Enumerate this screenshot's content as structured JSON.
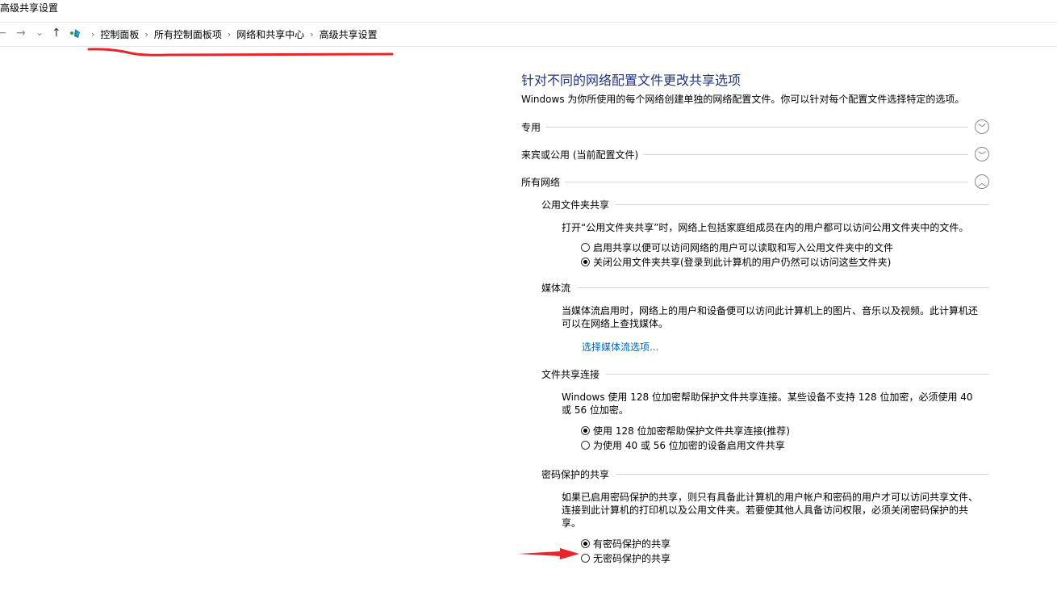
{
  "window": {
    "title": "高级共享设置"
  },
  "nav": {
    "back": "←",
    "forward": "→",
    "recent": "⌄",
    "up": "↑",
    "breadcrumb": [
      "控制面板",
      "所有控制面板项",
      "网络和共享中心",
      "高级共享设置"
    ],
    "separator": "›"
  },
  "main": {
    "heading": "针对不同的网络配置文件更改共享选项",
    "intro": "Windows 为你所使用的每个网络创建单独的网络配置文件。你可以针对每个配置文件选择特定的选项。",
    "profiles": [
      {
        "label": "专用",
        "state": "collapsed",
        "chevron": "﹀"
      },
      {
        "label": "来宾或公用 (当前配置文件)",
        "state": "collapsed",
        "chevron": "﹀"
      },
      {
        "label": "所有网络",
        "state": "expanded",
        "chevron": "︿"
      }
    ],
    "public_folder": {
      "title": "公用文件夹共享",
      "desc": "打开“公用文件夹共享”时，网络上包括家庭组成员在内的用户都可以访问公用文件夹中的文件。",
      "options": [
        {
          "label": "启用共享以便可以访问网络的用户可以读取和写入公用文件夹中的文件",
          "checked": false
        },
        {
          "label": "关闭公用文件夹共享(登录到此计算机的用户仍然可以访问这些文件夹)",
          "checked": true
        }
      ]
    },
    "media": {
      "title": "媒体流",
      "desc": "当媒体流启用时，网络上的用户和设备便可以访问此计算机上的图片、音乐以及视频。此计算机还可以在网络上查找媒体。",
      "link": "选择媒体流选项..."
    },
    "file_sharing": {
      "title": "文件共享连接",
      "desc": "Windows 使用 128 位加密帮助保护文件共享连接。某些设备不支持 128 位加密，必须使用 40 或 56 位加密。",
      "options": [
        {
          "label": "使用 128 位加密帮助保护文件共享连接(推荐)",
          "checked": true
        },
        {
          "label": "为使用 40 或 56 位加密的设备启用文件共享",
          "checked": false
        }
      ]
    },
    "password": {
      "title": "密码保护的共享",
      "desc": "如果已启用密码保护的共享，则只有具备此计算机的用户帐户和密码的用户才可以访问共享文件、连接到此计算机的打印机以及公用文件夹。若要使其他人具备访问权限，必须关闭密码保护的共享。",
      "options": [
        {
          "label": "有密码保护的共享",
          "checked": true
        },
        {
          "label": "无密码保护的共享",
          "checked": false
        }
      ]
    }
  },
  "annotation_color": "#e8262a"
}
